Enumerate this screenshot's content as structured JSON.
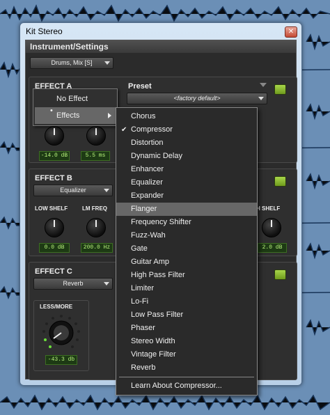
{
  "window": {
    "title": "Kit Stereo"
  },
  "header": "Instrument/Settings",
  "track": {
    "selector": "Drums, Mix [S]"
  },
  "effect_a": {
    "label": "EFFECT A",
    "preset_label": "Preset",
    "preset_value": "<factory default>",
    "value1": "-14.0 dB",
    "value2": "5.5 ms"
  },
  "effect_b": {
    "label": "EFFECT B",
    "selector": "Equalizer",
    "low_shelf": "LOW SHELF",
    "lm_freq": "LM FREQ",
    "h_shelf": "H SHELF",
    "low_shelf_val": "0.0 dB",
    "lm_freq_val": "200.0 Hz",
    "h_shelf_val": "2.0 dB"
  },
  "effect_c": {
    "label": "EFFECT C",
    "selector": "Reverb",
    "less_more": "LESS/MORE",
    "value": "-43.3 db"
  },
  "effect_menu": {
    "no_effect": "No Effect",
    "effects": "Effects"
  },
  "submenu": {
    "items": [
      "Chorus",
      "Compressor",
      "Distortion",
      "Dynamic Delay",
      "Enhancer",
      "Equalizer",
      "Expander",
      "Flanger",
      "Frequency Shifter",
      "Fuzz-Wah",
      "Gate",
      "Guitar Amp",
      "High Pass Filter",
      "Limiter",
      "Lo-Fi",
      "Low Pass Filter",
      "Phaser",
      "Stereo Width",
      "Vintage Filter",
      "Reverb"
    ],
    "checked": "Compressor",
    "highlighted": "Flanger",
    "learn": "Learn About Compressor..."
  }
}
